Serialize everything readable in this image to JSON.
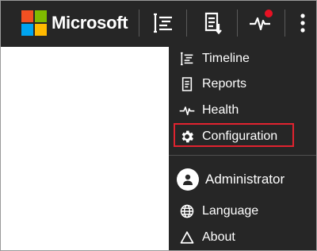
{
  "brand": {
    "name": "Microsoft",
    "logo_colors": [
      "#f25022",
      "#7fba00",
      "#00a4ef",
      "#ffb900"
    ]
  },
  "toolbar": {
    "buttons": [
      {
        "icon": "timeline-icon"
      },
      {
        "icon": "reports-icon"
      },
      {
        "icon": "health-icon",
        "badge_color": "#e81123"
      },
      {
        "icon": "more-vertical-icon"
      }
    ]
  },
  "menu": {
    "items": [
      {
        "label": "Timeline",
        "icon": "timeline-icon"
      },
      {
        "label": "Reports",
        "icon": "reports-icon"
      },
      {
        "label": "Health",
        "icon": "health-icon"
      },
      {
        "label": "Configuration",
        "icon": "gear-icon",
        "highlighted": true
      },
      {
        "label": "Administrator",
        "icon": "user-avatar-icon"
      },
      {
        "label": "Language",
        "icon": "globe-icon"
      },
      {
        "label": "About",
        "icon": "triangle-icon"
      }
    ],
    "highlight_color": "#e0232f"
  },
  "colors": {
    "topbar": "#262626",
    "menu_bg": "#262626",
    "text": "#ffffff"
  }
}
